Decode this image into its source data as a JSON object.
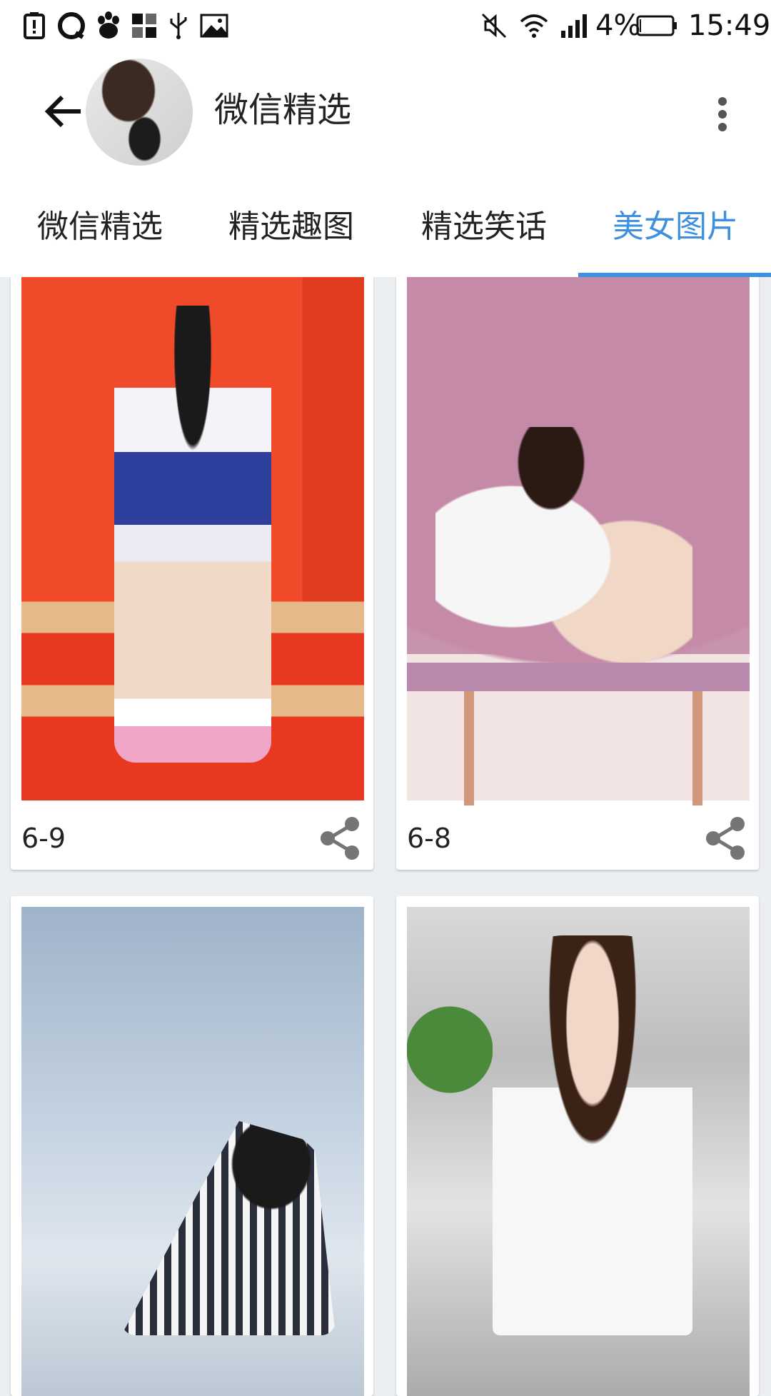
{
  "status_bar": {
    "battery_text": "4%",
    "time": "15:49",
    "left_icons": [
      "alert-icon",
      "qq-icon",
      "baidu-icon",
      "apps-icon",
      "usb-icon",
      "image-icon"
    ],
    "right_icons": [
      "mute-icon",
      "wifi-icon",
      "signal-icon",
      "battery-icon"
    ]
  },
  "app_bar": {
    "title": "微信精选",
    "back_icon": "back-arrow-icon",
    "more_icon": "more-vert-icon"
  },
  "tabs": [
    {
      "label": "微信精选",
      "active": false
    },
    {
      "label": "精选趣图",
      "active": false
    },
    {
      "label": "精选笑话",
      "active": false
    },
    {
      "label": "美女图片",
      "active": true
    }
  ],
  "accent_color": "#3d8fe0",
  "cards": [
    {
      "caption": "6-9",
      "share_icon": "share-icon"
    },
    {
      "caption": "6-8",
      "share_icon": "share-icon"
    },
    {
      "caption": "",
      "share_icon": ""
    },
    {
      "caption": "",
      "share_icon": ""
    }
  ]
}
